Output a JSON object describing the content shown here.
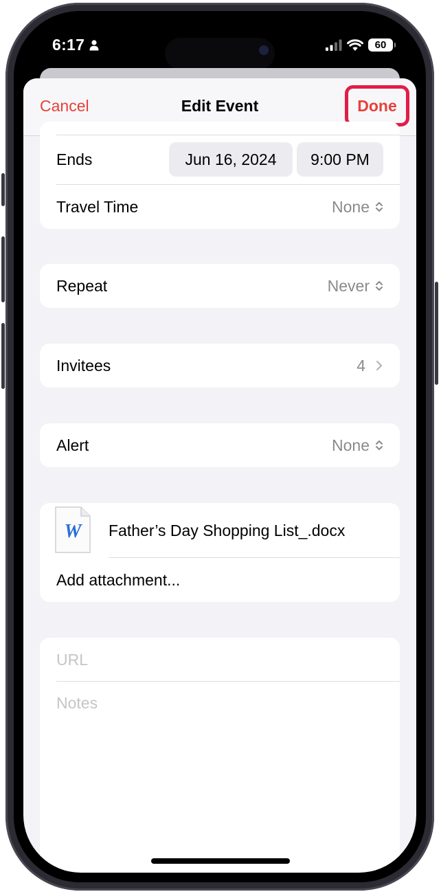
{
  "status_bar": {
    "time": "6:17",
    "battery": "60",
    "icons": [
      "person-icon",
      "cellular-signal-icon",
      "wifi-icon",
      "battery-icon"
    ]
  },
  "nav": {
    "cancel_label": "Cancel",
    "title": "Edit Event",
    "done_label": "Done",
    "accent_color": "#e5413a",
    "highlight_color": "#e11d48"
  },
  "ends": {
    "label": "Ends",
    "date": "Jun 16, 2024",
    "time": "9:00 PM"
  },
  "travel_time": {
    "label": "Travel Time",
    "value": "None"
  },
  "repeat": {
    "label": "Repeat",
    "value": "Never"
  },
  "invitees": {
    "label": "Invitees",
    "value": "4"
  },
  "alert": {
    "label": "Alert",
    "value": "None"
  },
  "attachments": {
    "items": [
      {
        "file_name": "Father’s Day Shopping List_.docx",
        "icon": "word-document-icon",
        "icon_letter": "W"
      }
    ],
    "add_label": "Add attachment..."
  },
  "url": {
    "placeholder": "URL"
  },
  "notes": {
    "placeholder": "Notes"
  }
}
